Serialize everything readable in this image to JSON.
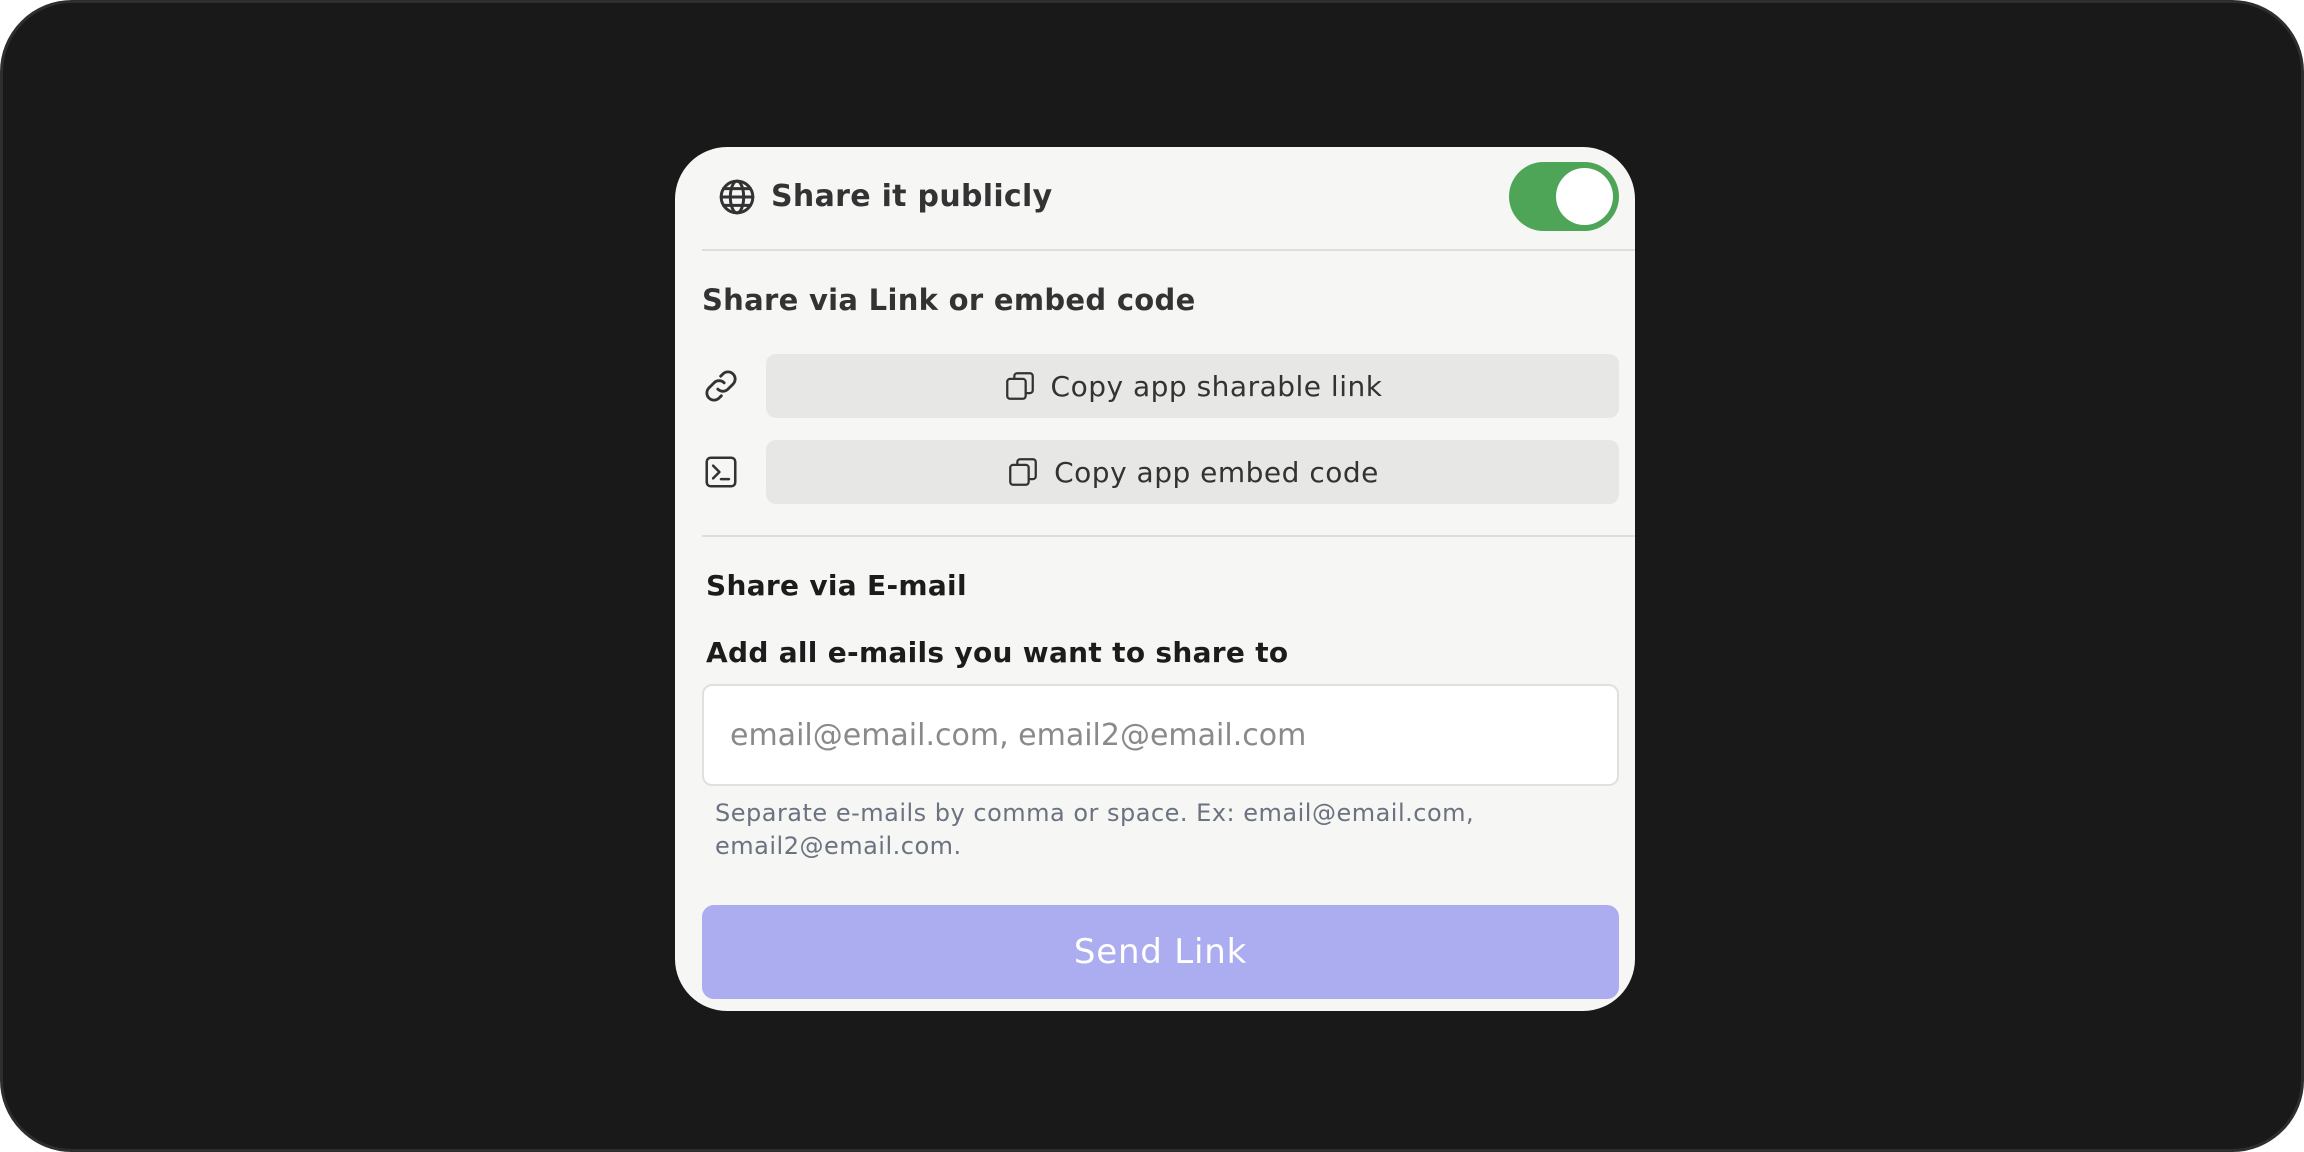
{
  "share_public": {
    "icon": "globe-icon",
    "label": "Share it publicly",
    "toggle_on": true,
    "toggle_color": "#4ea457"
  },
  "link_section": {
    "title": "Share via Link or embed code",
    "link_row": {
      "icon": "link-icon",
      "button_icon": "copy-icon",
      "button_label": "Copy app sharable link"
    },
    "embed_row": {
      "icon": "terminal-icon",
      "button_icon": "copy-icon",
      "button_label": "Copy app embed code"
    }
  },
  "email_section": {
    "title": "Share via E-mail",
    "input_label": "Add all e-mails you want to share to",
    "input_placeholder": "email@email.com, email2@email.com",
    "input_value": "",
    "helper_text": "Separate e-mails by comma or space. Ex: email@email.com, email2@email.com.",
    "send_label": "Send Link",
    "send_color": "#acacf0"
  }
}
